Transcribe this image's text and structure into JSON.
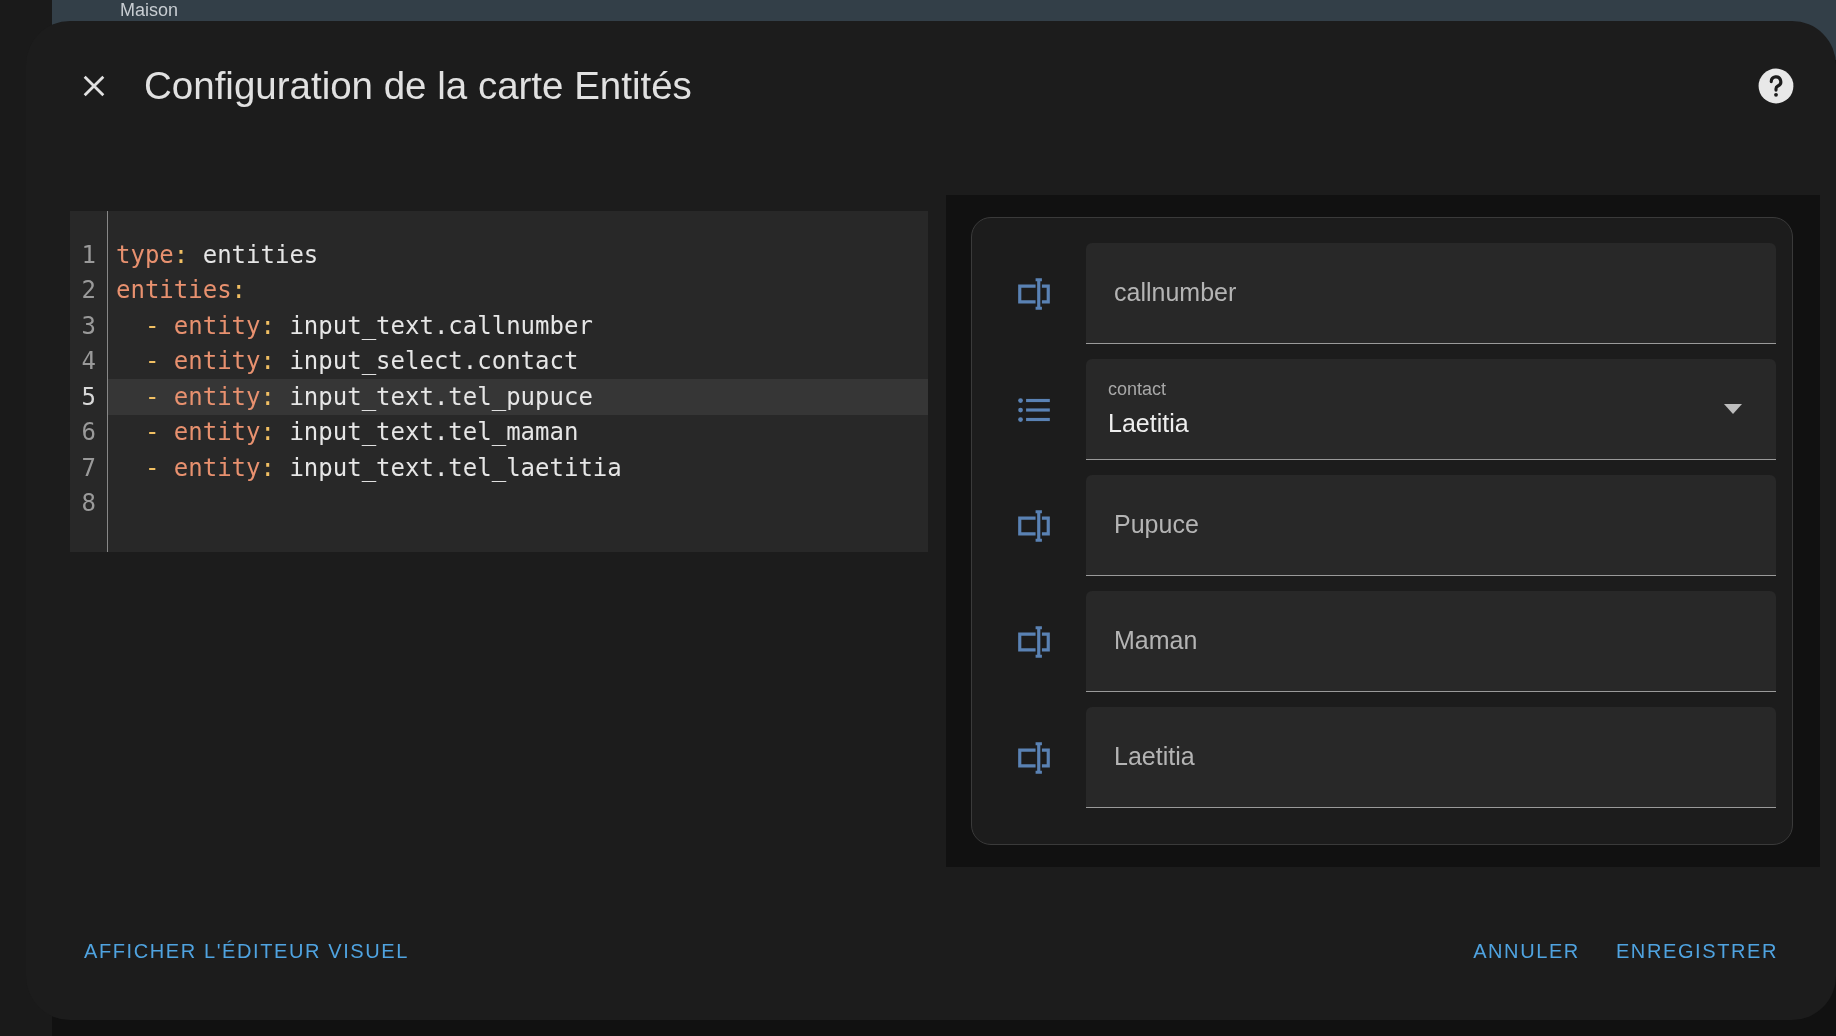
{
  "background": {
    "header_title": "Maison"
  },
  "dialog": {
    "title": "Configuration de la carte Entités"
  },
  "editor": {
    "lines": [
      {
        "number": "1",
        "active": false,
        "tokens": [
          {
            "kind": "key",
            "text": "type"
          },
          {
            "kind": "punct",
            "text": ":"
          },
          {
            "kind": "value",
            "text": " entities"
          }
        ]
      },
      {
        "number": "2",
        "active": false,
        "tokens": [
          {
            "kind": "key",
            "text": "entities"
          },
          {
            "kind": "punct",
            "text": ":"
          }
        ]
      },
      {
        "number": "3",
        "active": false,
        "tokens": [
          {
            "kind": "punct",
            "text": "  - "
          },
          {
            "kind": "key",
            "text": "entity"
          },
          {
            "kind": "punct",
            "text": ":"
          },
          {
            "kind": "value",
            "text": " input_text.callnumber"
          }
        ]
      },
      {
        "number": "4",
        "active": false,
        "tokens": [
          {
            "kind": "punct",
            "text": "  - "
          },
          {
            "kind": "key",
            "text": "entity"
          },
          {
            "kind": "punct",
            "text": ":"
          },
          {
            "kind": "value",
            "text": " input_select.contact"
          }
        ]
      },
      {
        "number": "5",
        "active": true,
        "tokens": [
          {
            "kind": "punct",
            "text": "  - "
          },
          {
            "kind": "key",
            "text": "entity"
          },
          {
            "kind": "punct",
            "text": ":"
          },
          {
            "kind": "value",
            "text": " input_text.tel_pupuce"
          }
        ]
      },
      {
        "number": "6",
        "active": false,
        "tokens": [
          {
            "kind": "punct",
            "text": "  - "
          },
          {
            "kind": "key",
            "text": "entity"
          },
          {
            "kind": "punct",
            "text": ":"
          },
          {
            "kind": "value",
            "text": " input_text.tel_maman"
          }
        ]
      },
      {
        "number": "7",
        "active": false,
        "tokens": [
          {
            "kind": "punct",
            "text": "  - "
          },
          {
            "kind": "key",
            "text": "entity"
          },
          {
            "kind": "punct",
            "text": ":"
          },
          {
            "kind": "value",
            "text": " input_text.tel_laetitia"
          }
        ]
      },
      {
        "number": "8",
        "active": false
      }
    ]
  },
  "preview": {
    "rows": [
      {
        "kind": "text",
        "value": "callnumber"
      },
      {
        "kind": "select",
        "label": "contact",
        "value": "Laetitia"
      },
      {
        "kind": "text",
        "value": "Pupuce"
      },
      {
        "kind": "text",
        "value": "Maman"
      },
      {
        "kind": "text",
        "value": "Laetitia"
      }
    ]
  },
  "footer": {
    "left_button": "AFFICHER L'ÉDITEUR VISUEL",
    "right_buttons": [
      "ANNULER",
      "ENREGISTRER"
    ]
  }
}
